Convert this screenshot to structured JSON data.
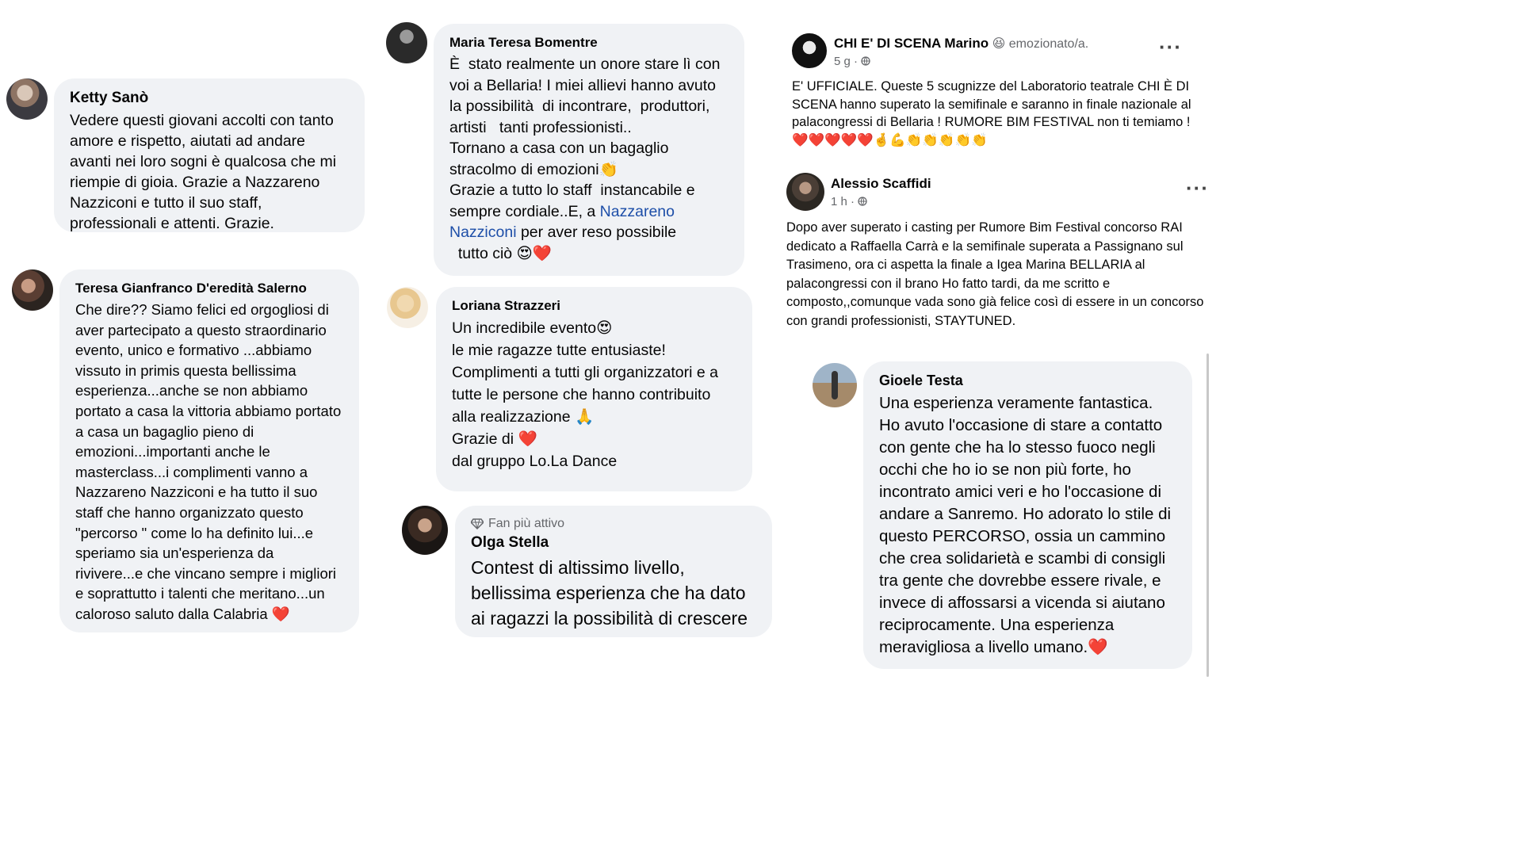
{
  "comments": {
    "ketty": {
      "author": "Ketty Sanò",
      "text": "Vedere questi giovani accolti con tanto amore e rispetto, aiutati ad andare avanti nei loro sogni è qualcosa che mi riempie di gioia. Grazie a Nazzareno Nazziconi e tutto il suo staff, professionali e attenti. Grazie."
    },
    "teresa": {
      "author": "Teresa Gianfranco D'eredità Salerno",
      "text": "Che dire?? Siamo felici ed orgogliosi di aver partecipato a questo straordinario evento, unico e formativo ...abbiamo vissuto in primis questa bellissima esperienza...anche se non abbiamo portato a casa la vittoria abbiamo portato a casa un bagaglio pieno di emozioni...importanti anche le masterclass...i complimenti vanno a Nazzareno Nazziconi e ha tutto il suo staff che hanno organizzato questo \"percorso \" come lo ha definito lui...e speriamo sia un'esperienza da rivivere...e che vincano sempre i migliori e soprattutto i talenti che meritano...un caloroso saluto dalla Calabria ❤️"
    },
    "maria": {
      "author": "Maria Teresa Bomentre",
      "text1": "È  stato realmente un onore stare lì con voi a Bellaria! I miei allievi hanno avuto la possibilità  di incontrare,  produttori, artisti   tanti professionisti..\nTornano a casa con un bagaglio stracolmo di emozioni👏\nGrazie a tutto lo staff  instancabile e sempre cordiale..E, a ",
      "link": "Nazzareno Nazziconi",
      "text2": " per aver reso possibile\n  tutto ciò 😍❤️"
    },
    "loriana": {
      "author": "Loriana Strazzeri",
      "text": "Un incredibile evento😍\nle mie ragazze tutte entusiaste!\nComplimenti a tutti gli organizzatori e a tutte le persone che hanno contribuito alla realizzazione 🙏\nGrazie di ❤️\ndal gruppo Lo.La Dance"
    },
    "olga": {
      "badge": "Fan più attivo",
      "author": "Olga Stella",
      "text": "Contest di altissimo livello, bellissima esperienza che ha dato ai ragazzi la possibilità di crescere"
    },
    "gioele": {
      "author": "Gioele Testa",
      "text": "Una esperienza veramente fantastica. Ho avuto l'occasione di stare a contatto con gente che ha lo stesso fuoco negli occhi che ho io se non più forte, ho incontrato amici veri e ho l'occasione di andare a Sanremo. Ho adorato lo stile di questo PERCORSO, ossia un cammino che crea solidarietà e scambi di consigli tra gente che dovrebbe essere rivale, e invece di affossarsi a vicenda si aiutano reciprocamente. Una esperienza meravigliosa a livello umano.❤️"
    }
  },
  "posts": {
    "chi": {
      "name": "CHI E' DI SCENA Marino",
      "status": "😆 emozionato/a.",
      "time": "5 g ·",
      "text": "E' UFFICIALE.  Queste 5 scugnizze del Laboratorio teatrale CHI È DI SCENA hanno superato la semifinale e saranno in finale nazionale al palacongressi di Bellaria !  RUMORE BIM FESTIVAL non ti temiamo !❤️❤️❤️❤️❤️🤞💪👏👏👏👏👏"
    },
    "alessio": {
      "name": "Alessio Scaffidi",
      "time": "1 h ·",
      "text": "Dopo aver superato i casting per Rumore Bim Festival concorso RAI dedicato a Raffaella Carrà e la semifinale superata a Passignano sul Trasimeno, ora ci aspetta la finale a Igea Marina BELLARIA al palacongressi con il brano Ho fatto tardi, da me scritto e composto,,comunque vada sono già felice così di essere in un concorso con grandi professionisti, STAYTUNED."
    }
  },
  "icons": {
    "more": "more-options-icon",
    "globe": "globe-icon",
    "diamond": "diamond-icon"
  }
}
